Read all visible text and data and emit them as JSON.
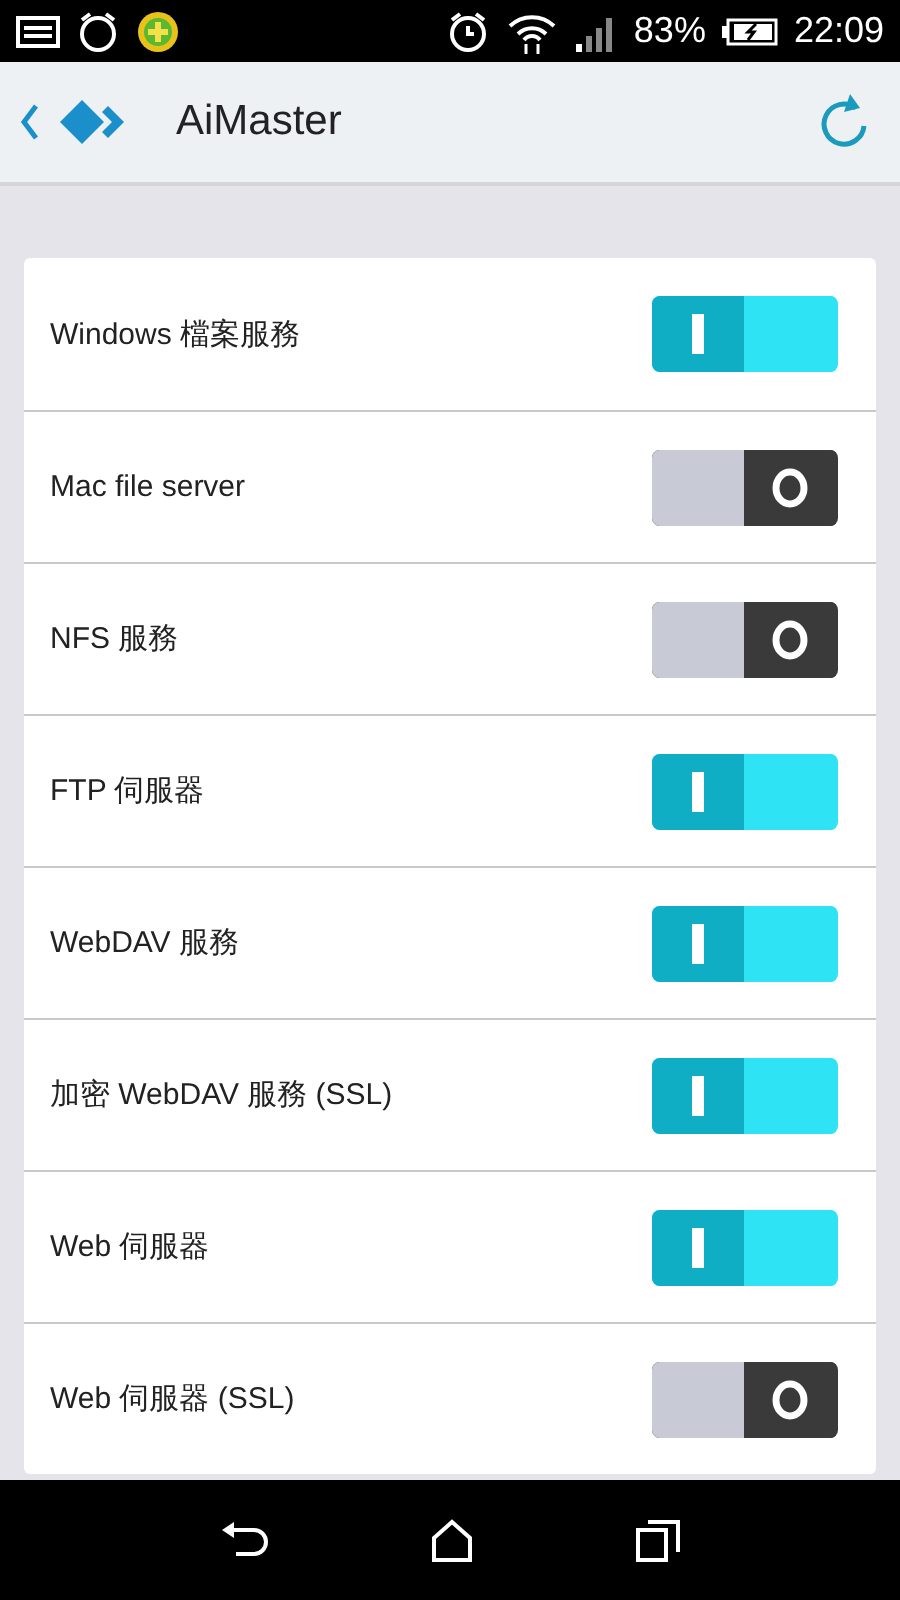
{
  "status_bar": {
    "battery": "83%",
    "time": "22:09"
  },
  "header": {
    "title": "AiMaster"
  },
  "services": [
    {
      "label": "Windows 檔案服務",
      "on": true
    },
    {
      "label": "Mac file server",
      "on": false
    },
    {
      "label": "NFS 服務",
      "on": false
    },
    {
      "label": "FTP 伺服器",
      "on": true
    },
    {
      "label": "WebDAV 服務",
      "on": true
    },
    {
      "label": "加密 WebDAV 服務 (SSL)",
      "on": true
    },
    {
      "label": "Web 伺服器",
      "on": true
    },
    {
      "label": "Web 伺服器 (SSL)",
      "on": false
    }
  ]
}
